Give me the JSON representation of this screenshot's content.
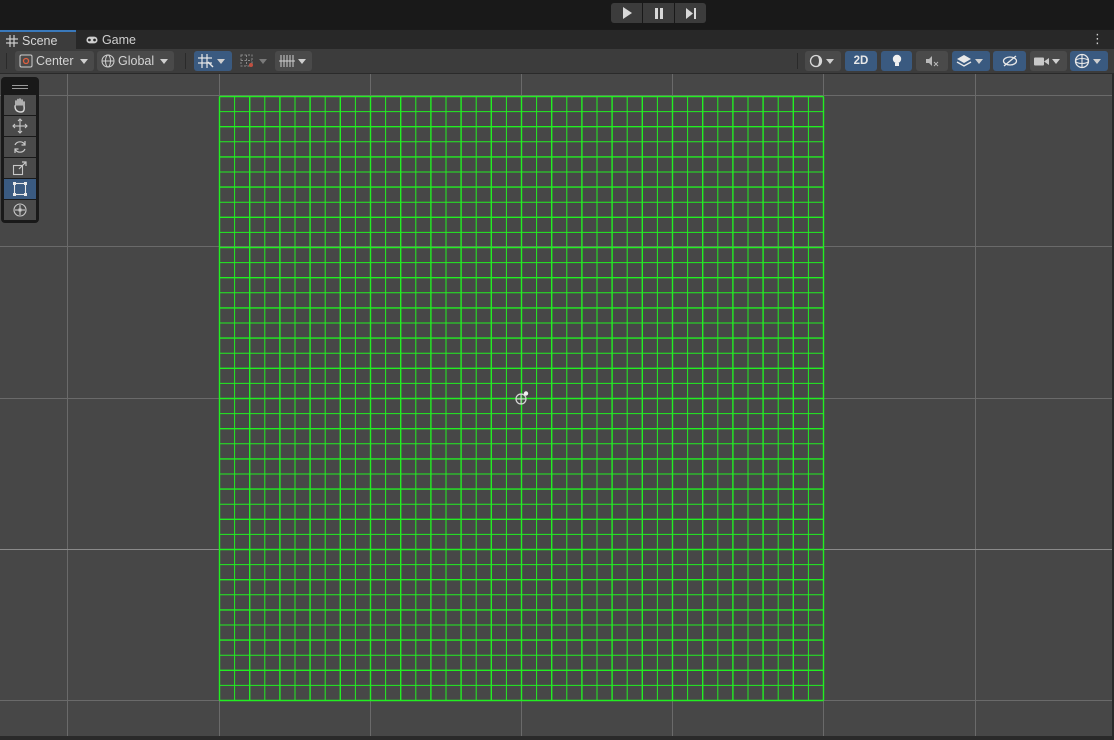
{
  "playbar": {
    "buttons": [
      {
        "icon": "play-icon"
      },
      {
        "icon": "pause-icon"
      },
      {
        "icon": "step-icon"
      }
    ]
  },
  "tabs": [
    {
      "label": "Scene",
      "icon": "grid-icon",
      "active": true
    },
    {
      "label": "Game",
      "icon": "gamepad-icon",
      "active": false
    }
  ],
  "toolbar": {
    "pivot_mode": "Center",
    "pivot_rotation": "Global",
    "scene_2d_label": "2D"
  },
  "tools": [
    {
      "name": "hand-tool",
      "icon": "hand-icon",
      "active": false
    },
    {
      "name": "move-tool",
      "icon": "move-icon",
      "active": false
    },
    {
      "name": "rotate-tool",
      "icon": "rotate-icon",
      "active": false
    },
    {
      "name": "scale-tool",
      "icon": "scale-icon",
      "active": false
    },
    {
      "name": "rect-tool",
      "icon": "rect-icon",
      "active": true
    },
    {
      "name": "transform-tool",
      "icon": "transform-icon",
      "active": false
    }
  ],
  "scene": {
    "tilemap_grid_color": "#22ee22",
    "editor_grid_color": "#6a6a6a",
    "background_color": "#474747",
    "tilemap_columns": 40,
    "tilemap_rows": 40
  },
  "colors": {
    "accent": "#3a79bb",
    "active_button": "#3a5a80"
  }
}
